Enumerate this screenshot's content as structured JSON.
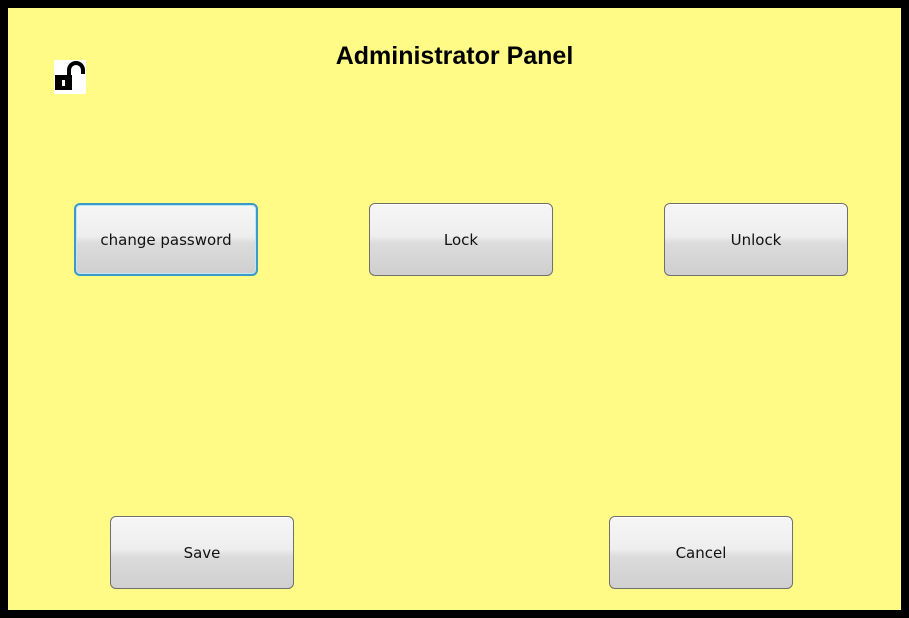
{
  "panel": {
    "title": "Administrator Panel",
    "status_icon": "unlocked-padlock-icon",
    "colors": {
      "background": "#fffb86",
      "border": "#000000",
      "focus_ring": "#3a9ac8"
    }
  },
  "buttons": {
    "change_password": "change password",
    "lock": "Lock",
    "unlock": "Unlock",
    "save": "Save",
    "cancel": "Cancel"
  }
}
